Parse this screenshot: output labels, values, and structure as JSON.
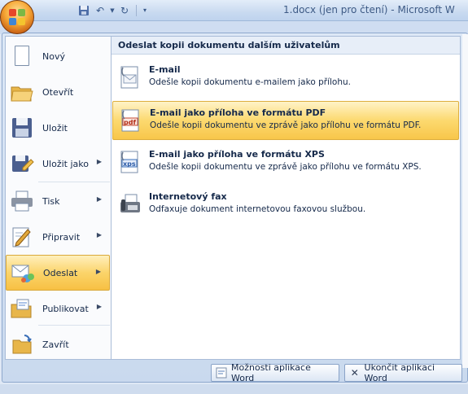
{
  "window": {
    "title": "1.docx (jen pro čtení) - Microsoft W"
  },
  "left_menu": {
    "items": [
      {
        "label": "Nový",
        "has_arrow": false
      },
      {
        "label": "Otevřít",
        "has_arrow": false
      },
      {
        "label": "Uložit",
        "has_arrow": false
      },
      {
        "label": "Uložit jako",
        "has_arrow": true
      },
      {
        "label": "Tisk",
        "has_arrow": true
      },
      {
        "label": "Připravit",
        "has_arrow": true
      },
      {
        "label": "Odeslat",
        "has_arrow": true,
        "active": true
      },
      {
        "label": "Publikovat",
        "has_arrow": true
      },
      {
        "label": "Zavřít",
        "has_arrow": false
      }
    ],
    "arrow_glyph": "▶"
  },
  "submenu": {
    "header": "Odeslat kopii dokumentu dalším uživatelům",
    "options": [
      {
        "title": "E-mail",
        "description": "Odešle kopii dokumentu e-mailem jako přílohu.",
        "icon": "email-icon"
      },
      {
        "title": "E-mail jako příloha ve formátu PDF",
        "description": "Odešle kopii dokumentu ve zprávě jako přílohu ve formátu PDF.",
        "icon": "pdf-attachment-icon",
        "active": true
      },
      {
        "title": "E-mail jako příloha ve formátu XPS",
        "description": "Odešle kopii dokumentu ve zprávě jako přílohu ve formátu XPS.",
        "icon": "xps-attachment-icon"
      },
      {
        "title": "Internetový fax",
        "description": "Odfaxuje dokument internetovou faxovou službou.",
        "icon": "fax-icon"
      }
    ],
    "pdf_badge": "pdf",
    "xps_badge": "xps"
  },
  "footer": {
    "options_button": "Možnosti aplikace Word",
    "exit_button": "Ukončit aplikaci Word"
  },
  "colors": {
    "highlight": "#f8c64a",
    "frame": "#c9d9ee",
    "text": "#15294a"
  }
}
